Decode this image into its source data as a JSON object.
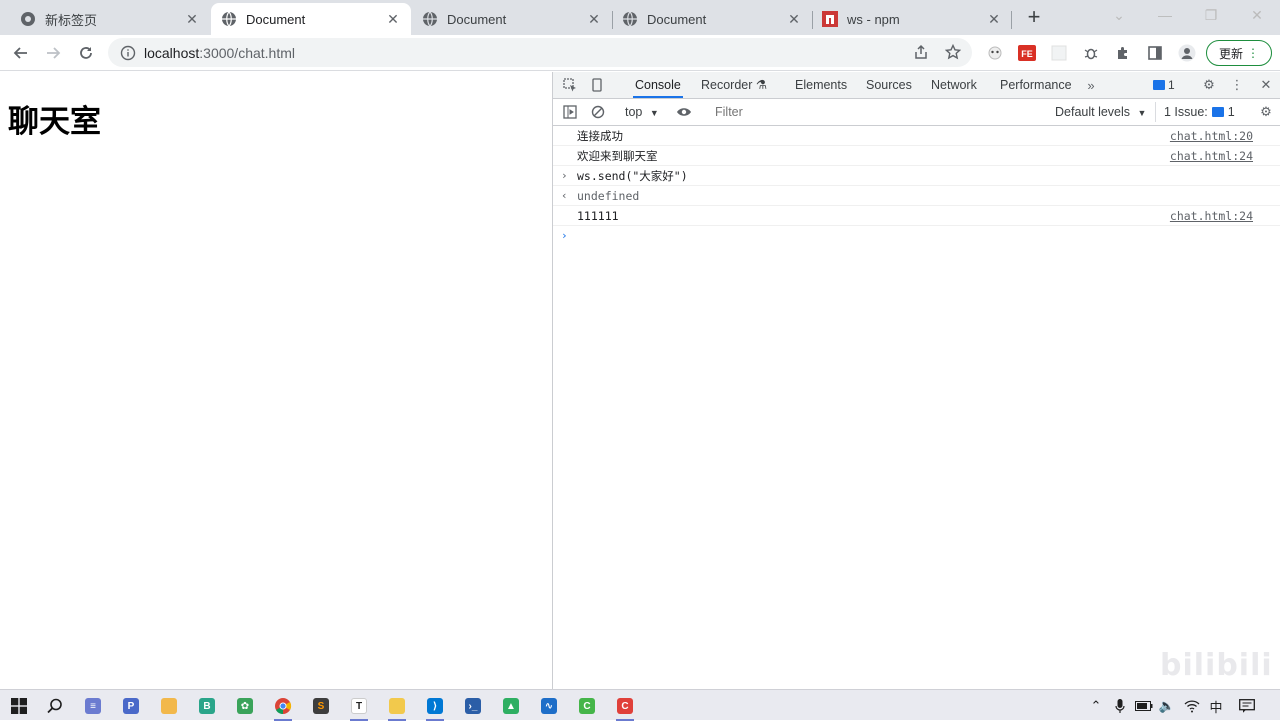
{
  "browser": {
    "tabs": [
      {
        "title": "新标签页",
        "favicon": "chrome-icon",
        "active": false
      },
      {
        "title": "Document",
        "favicon": "globe-icon",
        "active": true
      },
      {
        "title": "Document",
        "favicon": "globe-icon",
        "active": false
      },
      {
        "title": "Document",
        "favicon": "globe-icon",
        "active": false
      },
      {
        "title": "ws - npm",
        "favicon": "npm-icon",
        "active": false
      }
    ],
    "address": {
      "host": "localhost",
      "path": ":3000/chat.html"
    },
    "update_label": "更新"
  },
  "page": {
    "heading": "聊天室"
  },
  "devtools": {
    "tabs": [
      "Console",
      "Recorder",
      "Elements",
      "Sources",
      "Network",
      "Performance"
    ],
    "active_tab": "Console",
    "message_count": "1",
    "context": "top",
    "filter_placeholder": "Filter",
    "levels_label": "Default levels",
    "issues_label": "1 Issue:",
    "issues_count": "1",
    "console": [
      {
        "type": "log",
        "text": "连接成功",
        "source": "chat.html:20"
      },
      {
        "type": "log",
        "text": "欢迎来到聊天室",
        "source": "chat.html:24"
      },
      {
        "type": "input",
        "text": "ws.send(\"大家好\")",
        "source": ""
      },
      {
        "type": "result",
        "text": "undefined",
        "source": ""
      },
      {
        "type": "log",
        "text": "111111",
        "source": "chat.html:24"
      }
    ]
  },
  "taskbar": {
    "ime": "中"
  },
  "colors": {
    "accent": "#1a73e8",
    "tabstrip": "#dee1e6",
    "update_green": "#1e8e3e"
  }
}
